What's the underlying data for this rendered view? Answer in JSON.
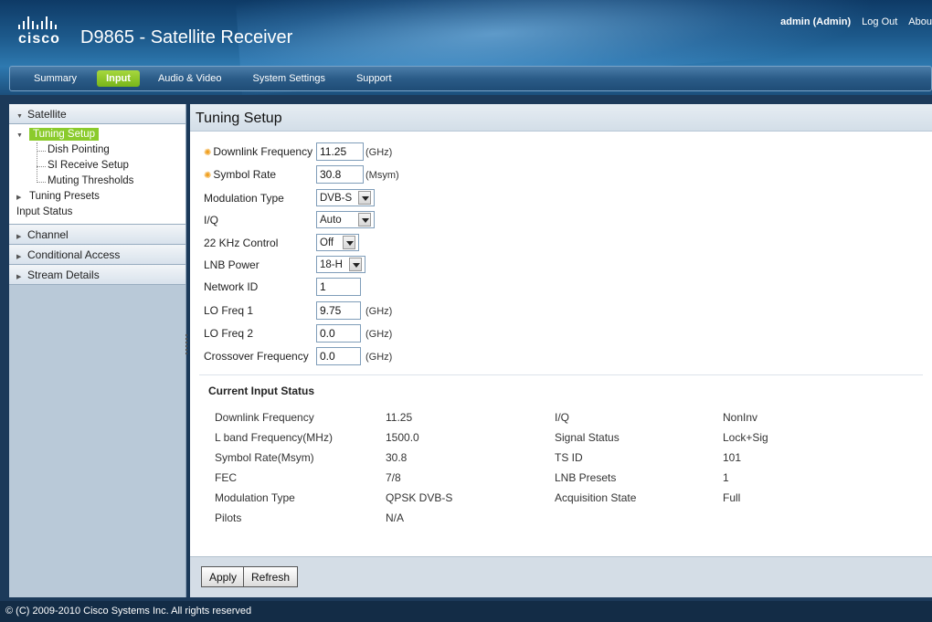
{
  "header": {
    "logo_text": "cisco",
    "title": "D9865 - Satellite Receiver",
    "user": "admin (Admin)",
    "logout": "Log Out",
    "about": "Abou"
  },
  "nav": {
    "tabs": [
      "Summary",
      "Input",
      "Audio & Video",
      "System Settings",
      "Support"
    ],
    "active": "Input"
  },
  "sidebar": {
    "satellite": "Satellite",
    "tuning_setup": "Tuning Setup",
    "dish_pointing": "Dish Pointing",
    "si_receive_setup": "SI Receive Setup",
    "muting_thresholds": "Muting Thresholds",
    "tuning_presets": "Tuning Presets",
    "input_status": "Input Status",
    "channel": "Channel",
    "conditional_access": "Conditional Access",
    "stream_details": "Stream Details"
  },
  "page": {
    "title": "Tuning Setup"
  },
  "form": {
    "downlink_frequency": {
      "label": "Downlink Frequency",
      "value": "11.25",
      "unit": "(GHz)"
    },
    "symbol_rate": {
      "label": "Symbol Rate",
      "value": "30.8",
      "unit": "(Msym)"
    },
    "modulation_type": {
      "label": "Modulation Type",
      "value": "DVB-S"
    },
    "iq": {
      "label": "I/Q",
      "value": "Auto"
    },
    "khz_control": {
      "label": "22 KHz Control",
      "value": "Off"
    },
    "lnb_power": {
      "label": "LNB Power",
      "value": "18-H"
    },
    "network_id": {
      "label": "Network ID",
      "value": "1"
    },
    "lo_freq1": {
      "label": "LO Freq 1",
      "value": "9.75",
      "unit": "(GHz)"
    },
    "lo_freq2": {
      "label": "LO Freq 2",
      "value": "0.0",
      "unit": "(GHz)"
    },
    "crossover_frequency": {
      "label": "Crossover Frequency",
      "value": "0.0",
      "unit": "(GHz)"
    }
  },
  "status": {
    "title": "Current Input Status",
    "rows": [
      {
        "l1": "Downlink Frequency",
        "v1": "11.25",
        "l2": "I/Q",
        "v2": "NonInv"
      },
      {
        "l1": "L band Frequency(MHz)",
        "v1": "1500.0",
        "l2": "Signal Status",
        "v2": "Lock+Sig"
      },
      {
        "l1": "Symbol Rate(Msym)",
        "v1": "30.8",
        "l2": "TS ID",
        "v2": "101"
      },
      {
        "l1": "FEC",
        "v1": "7/8",
        "l2": "LNB Presets",
        "v2": "1"
      },
      {
        "l1": "Modulation Type",
        "v1": "QPSK DVB-S",
        "l2": "Acquisition State",
        "v2": "Full"
      },
      {
        "l1": "Pilots",
        "v1": "N/A",
        "l2": "",
        "v2": ""
      }
    ]
  },
  "actions": {
    "apply": "Apply",
    "refresh": "Refresh"
  },
  "footer": {
    "text": "© (C) 2009-2010 Cisco Systems Inc. All rights reserved"
  },
  "colors": {
    "accent_green": "#8bcb2c",
    "header_blue": "#1d5a8c",
    "required_star": "#f0a020"
  }
}
